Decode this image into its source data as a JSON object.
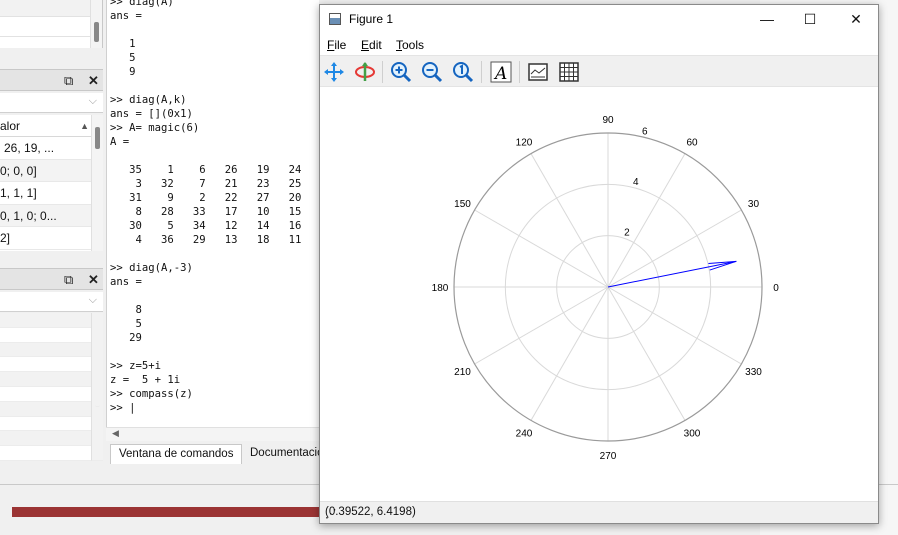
{
  "console_lines": [
    ">> diag(A)",
    "ans =",
    "",
    "   1",
    "   5",
    "   9",
    "",
    ">> diag(A,k)",
    "ans = [](0x1)",
    ">> A= magic(6)",
    "A =",
    "",
    "   35    1    6   26   19   24",
    "    3   32    7   21   23   25",
    "   31    9    2   22   27   20",
    "    8   28   33   17   10   15",
    "   30    5   34   12   14   16",
    "    4   36   29   13   18   11",
    "",
    ">> diag(A,-3)",
    "ans =",
    "",
    "    8",
    "    5",
    "   29",
    "",
    ">> z=5+i",
    "z =  5 + 1i",
    ">> compass(z)",
    ">> |"
  ],
  "workspace": {
    "header": "alor",
    "rows": [
      "26, 19, ...",
      "0; 0, 0]",
      "1, 1, 1]",
      "0, 1, 0; 0...",
      "2]"
    ]
  },
  "tabs": {
    "command_window": "Ventana de comandos",
    "documentation": "Documentació"
  },
  "figure": {
    "title": "Figure 1",
    "menu": {
      "file": "File",
      "file_key": "F",
      "file_rest": "ile",
      "edit": "Edit",
      "edit_key": "E",
      "edit_rest": "dit",
      "tools": "Tools",
      "tools_key": "T",
      "tools_rest": "ools"
    },
    "toolbar_icons": [
      "pan-icon",
      "rotate-icon",
      "zoom-in-icon",
      "zoom-out-icon",
      "zoom-reset-icon",
      "text-insert-icon",
      "axes-toggle-icon",
      "grid-toggle-icon"
    ],
    "status": "(0.39522, 6.4198)"
  },
  "chart_data": {
    "type": "compass",
    "angle_ticks": [
      "0",
      "30",
      "60",
      "90",
      "120",
      "150",
      "180",
      "210",
      "240",
      "270",
      "300",
      "330"
    ],
    "radial_ticks": [
      "2",
      "4",
      "6"
    ],
    "rmax": 6,
    "series": [
      {
        "x": 5,
        "y": 1,
        "color": "#0000ff"
      }
    ]
  },
  "colors": {
    "vector": "#0000ff",
    "grid": "#d9d9d9",
    "bottom_bar": "#9b3434"
  }
}
